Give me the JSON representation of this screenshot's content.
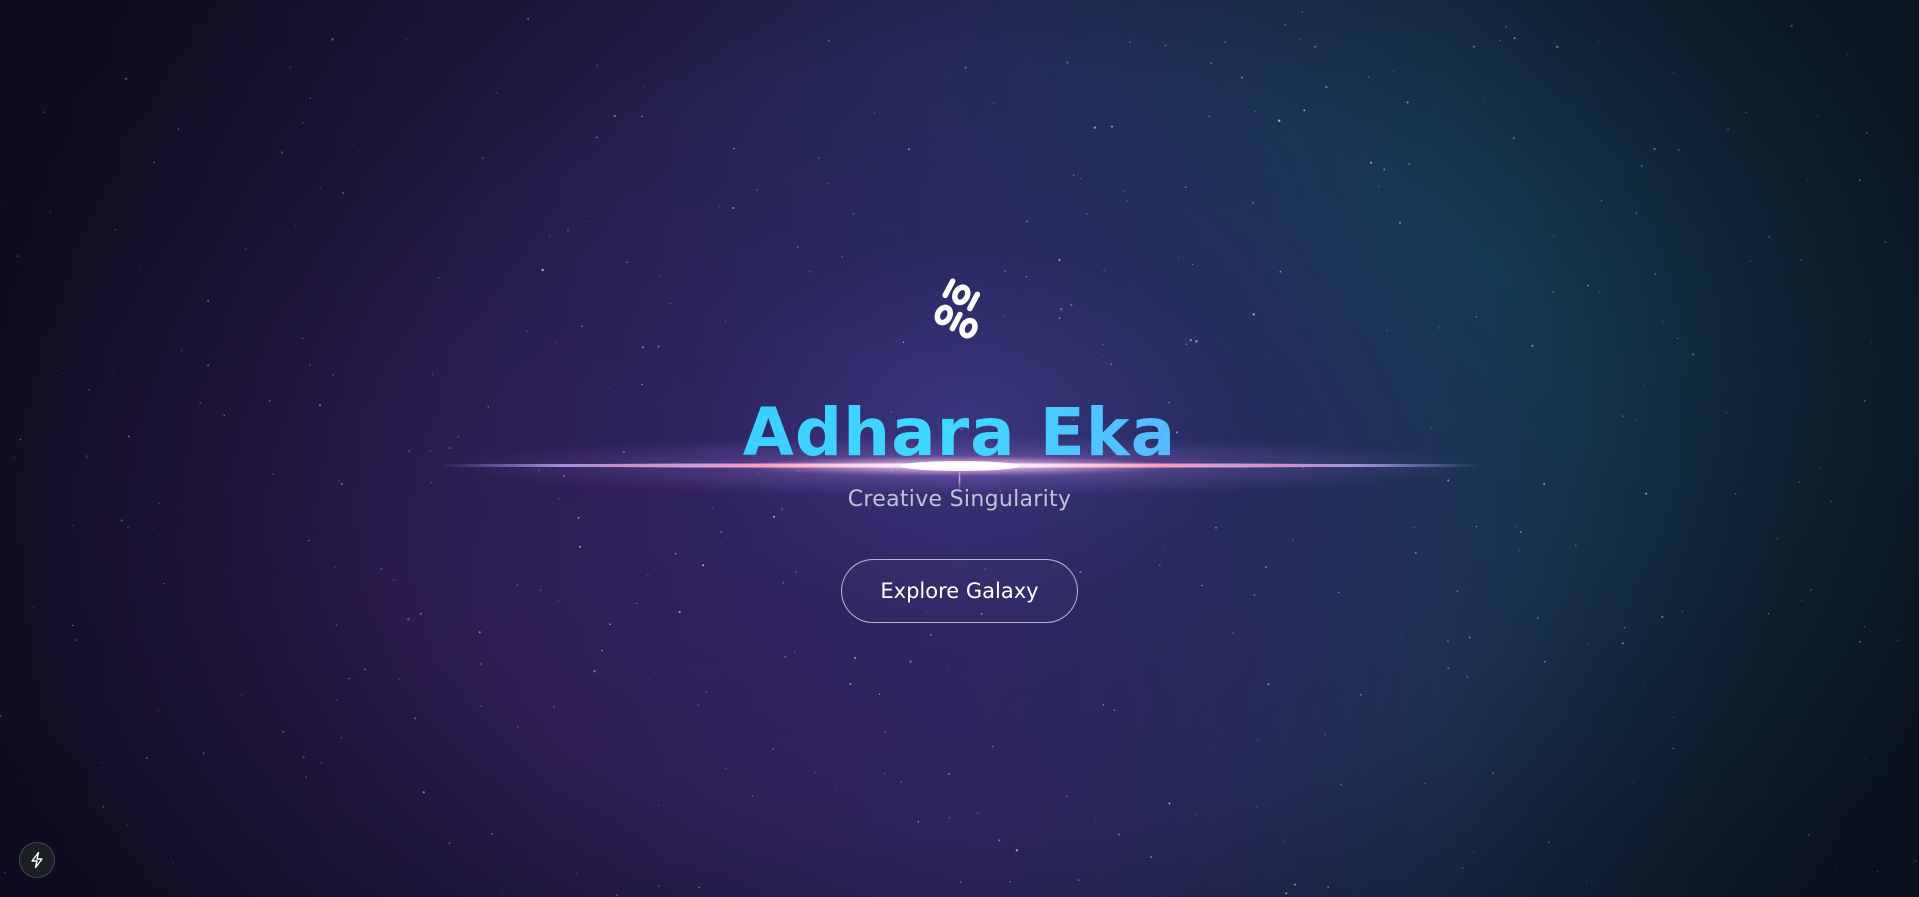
{
  "hero": {
    "logo_icon": "binary-diamond-icon",
    "title": "Adhara Eka",
    "tagline": "Creative Singularity",
    "cta_label": "Explore Galaxy"
  },
  "corner_button": {
    "icon": "lightning-bolt-icon"
  },
  "colors": {
    "title_gradient": [
      "#4aa3ff",
      "#38c8ff",
      "#a67dff"
    ],
    "glow_core": "#ffe6f4",
    "glow_edge": "#ff7aa8"
  }
}
